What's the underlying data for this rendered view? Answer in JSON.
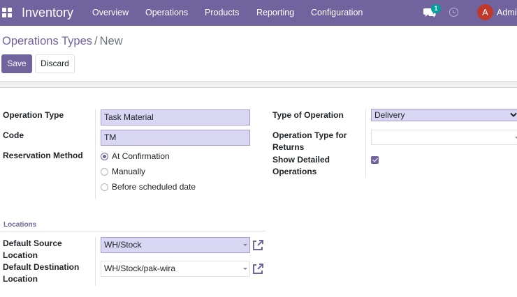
{
  "navbar": {
    "app_name": "Inventory",
    "menu": [
      "Overview",
      "Operations",
      "Products",
      "Reporting",
      "Configuration"
    ],
    "messages_badge": "1",
    "avatar_initial": "A",
    "user_name": "Admin"
  },
  "breadcrumb": {
    "parent": "Operations Types",
    "separator": "/",
    "current": "New"
  },
  "buttons": {
    "save": "Save",
    "discard": "Discard"
  },
  "form": {
    "operation_type": {
      "label": "Operation Type",
      "value": "Task Material"
    },
    "code": {
      "label": "Code",
      "value": "TM"
    },
    "reservation_method": {
      "label": "Reservation Method",
      "options": [
        "At Confirmation",
        "Manually",
        "Before scheduled date"
      ],
      "selected": "At Confirmation"
    },
    "type_of_operation": {
      "label": "Type of Operation",
      "value": "Delivery"
    },
    "return_type": {
      "label_line1": "Operation Type for",
      "label_line2": "Returns",
      "value": ""
    },
    "show_detailed": {
      "label_line1": "Show Detailed",
      "label_line2": "Operations",
      "checked": true
    },
    "locations": {
      "title": "Locations",
      "source": {
        "label_line1": "Default Source",
        "label_line2": "Location",
        "value": "WH/Stock"
      },
      "destination": {
        "label_line1": "Default Destination",
        "label_line2": "Location",
        "value": "WH/Stock/pak-wira"
      }
    }
  },
  "colors": {
    "brand": "#71639e",
    "required_field": "#d9d6f4",
    "badge": "#00a09d",
    "avatar": "#c0392b"
  }
}
